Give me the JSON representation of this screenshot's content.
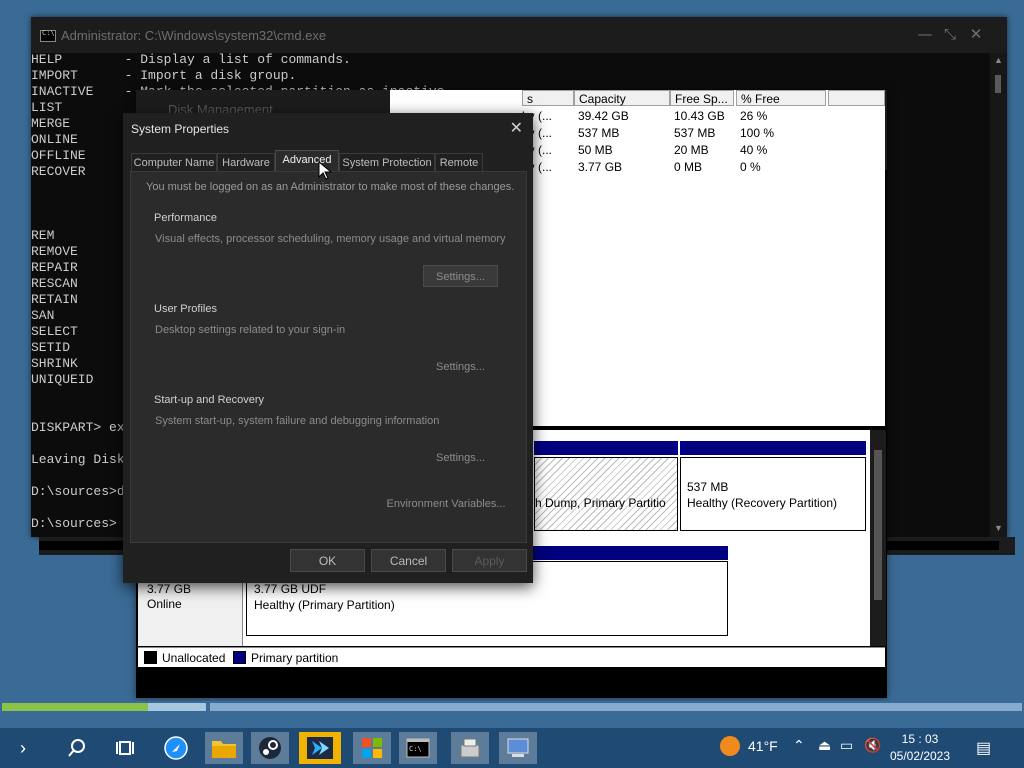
{
  "cmd": {
    "title": "Administrator: C:\\Windows\\system32\\cmd.exe",
    "lines": [
      "HELP        - Display a list of commands.",
      "IMPORT      - Import a disk group.",
      "INACTIVE    - Mark the selected partition as inactive.",
      "LIST",
      "MERGE",
      "ONLINE",
      "OFFLINE",
      "RECOVER",
      "",
      "",
      "",
      "REM",
      "REMOVE",
      "REPAIR",
      "RESCAN",
      "RETAIN",
      "SAN",
      "SELECT",
      "SETID",
      "SHRINK",
      "UNIQUEID",
      "",
      "",
      "DISKPART> exit",
      "",
      "Leaving DiskPart...",
      "",
      "D:\\sources>d",
      "",
      "D:\\sources>"
    ]
  },
  "dm": {
    "title": "Disk Management",
    "columns": [
      "s",
      "Capacity",
      "Free Sp...",
      "% Free"
    ],
    "rows": [
      [
        "hy (...",
        "39.42 GB",
        "10.43 GB",
        "26 %"
      ],
      [
        "hy (...",
        "537 MB",
        "537 MB",
        "100 %"
      ],
      [
        "hy (...",
        "50 MB",
        "20 MB",
        "40 %"
      ],
      [
        "hy (...",
        "3.77 GB",
        "0 MB",
        "0 %"
      ]
    ],
    "partitions": {
      "crash_dump": "h Dump, Primary Partitio",
      "recovery_size": "537 MB",
      "recovery_status": "Healthy (Recovery Partition)",
      "disk1_size": "3.77 GB",
      "disk1_status": "Online",
      "udf_size": "3.77 GB UDF",
      "udf_status": "Healthy (Primary Partition)"
    },
    "legend": {
      "unallocated": "Unallocated",
      "primary": "Primary partition"
    },
    "colors": {
      "primary": "#000080",
      "unallocated": "#000000"
    }
  },
  "system_properties": {
    "title": "System Properties",
    "tabs": [
      "Computer Name",
      "Hardware",
      "Advanced",
      "System Protection",
      "Remote"
    ],
    "active_tab": "Advanced",
    "note": "You must be logged on as an Administrator to make most of these changes.",
    "performance": {
      "heading": "Performance",
      "desc": "Visual effects, processor scheduling, memory usage and virtual memory",
      "button": "Settings..."
    },
    "user_profiles": {
      "heading": "User Profiles",
      "desc": "Desktop settings related to your sign-in",
      "button": "Settings..."
    },
    "startup": {
      "heading": "Start-up and Recovery",
      "desc": "System start-up, system failure and debugging information",
      "button": "Settings..."
    },
    "env_button": "Environment Variables...",
    "ok": "OK",
    "cancel": "Cancel",
    "apply": "Apply"
  },
  "taskbar": {
    "temperature": "41°F",
    "time": "15 : 03",
    "date": "05/02/2023",
    "icons": [
      "chevron-right-icon",
      "search-icon",
      "task-view-icon",
      "browser-icon",
      "file-explorer-icon",
      "steam-icon",
      "app-arrow-icon",
      "windows-icon",
      "cmd-icon",
      "installer-icon",
      "disk-management-icon"
    ]
  }
}
